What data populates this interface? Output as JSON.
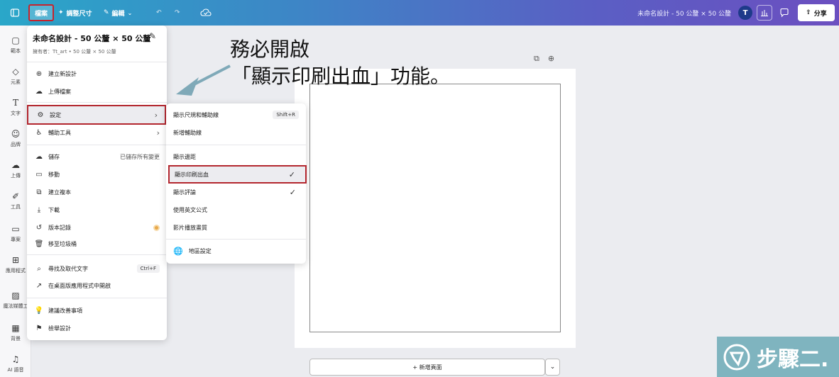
{
  "topbar": {
    "file_label": "檔案",
    "resize_label": "調整尺寸",
    "edit_label": "編輯",
    "doc_title": "未命名設計 - 50 公釐 × 50 公釐",
    "avatar_letter": "T",
    "share_label": "分享"
  },
  "sidebar": {
    "items": [
      {
        "label": "範本"
      },
      {
        "label": "元素"
      },
      {
        "label": "文字"
      },
      {
        "label": "品牌"
      },
      {
        "label": "上傳"
      },
      {
        "label": "工具"
      },
      {
        "label": "專案"
      },
      {
        "label": "應用程式"
      },
      {
        "label": "魔法媒體工"
      },
      {
        "label": "背景"
      },
      {
        "label": "AI 語音"
      }
    ]
  },
  "file_menu": {
    "title": "未命名設計 - 50 公釐 × 50 公釐",
    "owner": "擁有者：Tt_art • 50 公釐 × 50 公釐",
    "items": {
      "create_new": "建立新設計",
      "upload": "上傳檔案",
      "settings": "設定",
      "accessibility": "輔助工具",
      "save": "儲存",
      "save_status": "已儲存所有變更",
      "move": "移動",
      "make_copy": "建立複本",
      "download": "下載",
      "version_history": "版本記錄",
      "trash": "移至垃圾桶",
      "find_replace": "尋找及取代文字",
      "find_shortcut": "Ctrl+F",
      "open_desktop": "在桌面版應用程式中開啟",
      "suggest": "建議改善事項",
      "report": "檢舉設計"
    }
  },
  "settings_menu": {
    "show_rulers": "顯示尺規和輔助線",
    "rulers_shortcut": "Shift+R",
    "add_guides": "新增輔助線",
    "show_margins": "顯示邊距",
    "show_bleed": "顯示印刷出血",
    "show_comments": "顯示評論",
    "english_formula": "使用英文公式",
    "video_quality": "影片播放畫質",
    "region": "地區設定"
  },
  "canvas": {
    "add_page": "+ 新增頁面"
  },
  "annotation": {
    "line1": "務必開啟",
    "line2": "「顯示印刷出血」功能。"
  },
  "watermark": {
    "text": "步驟二."
  }
}
